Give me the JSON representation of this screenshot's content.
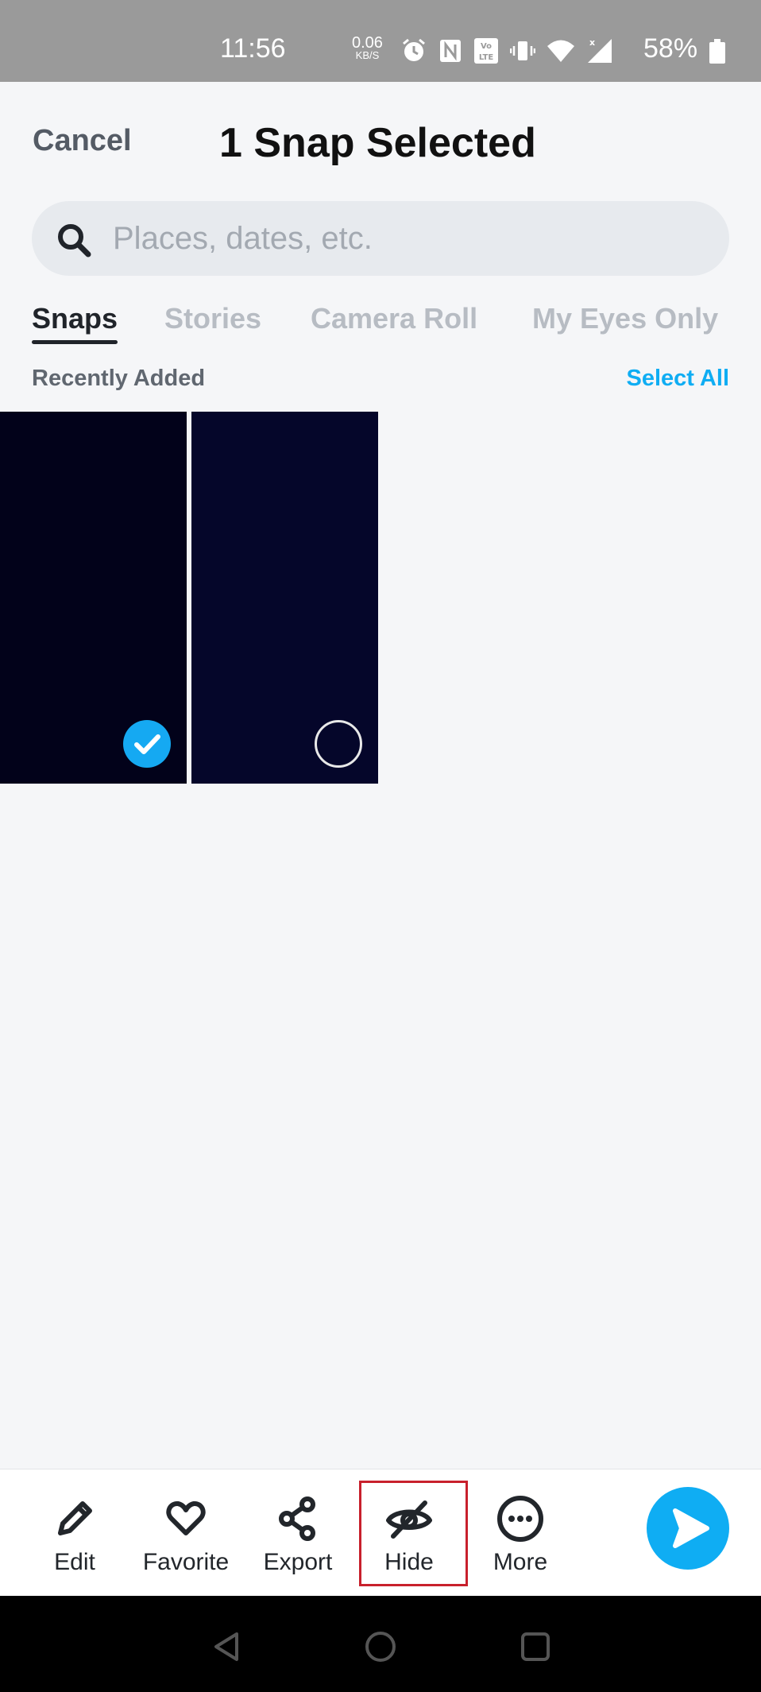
{
  "status_bar": {
    "time": "11:56",
    "net_speed_value": "0.06",
    "net_speed_unit": "KB/S",
    "battery": "58%",
    "icons": [
      "alarm-icon",
      "nfc-icon",
      "volte-icon",
      "vibrate-icon",
      "wifi-icon",
      "signal-icon",
      "battery-icon"
    ]
  },
  "header": {
    "cancel_label": "Cancel",
    "title": "1 Snap Selected"
  },
  "search": {
    "placeholder": "Places, dates, etc."
  },
  "tabs": [
    {
      "label": "Snaps",
      "active": true
    },
    {
      "label": "Stories",
      "active": false
    },
    {
      "label": "Camera Roll",
      "active": false
    },
    {
      "label": "My Eyes Only",
      "active": false
    }
  ],
  "section": {
    "label": "Recently Added",
    "select_all_label": "Select All"
  },
  "snaps": [
    {
      "selected": true,
      "color": "#02021a"
    },
    {
      "selected": false,
      "color": "#05062a"
    }
  ],
  "actions": [
    {
      "label": "Edit",
      "icon": "pencil-icon"
    },
    {
      "label": "Favorite",
      "icon": "heart-icon"
    },
    {
      "label": "Export",
      "icon": "share-icon"
    },
    {
      "label": "Hide",
      "icon": "eye-slash-icon",
      "highlighted": true
    },
    {
      "label": "More",
      "icon": "more-dots-icon"
    }
  ],
  "send_icon": "send-arrow-icon",
  "nav_icons": [
    "back-icon",
    "home-icon",
    "recents-icon"
  ],
  "colors": {
    "accent": "#0fadf3",
    "highlight": "#c8202c",
    "status_bar": "#9a9a9a"
  }
}
